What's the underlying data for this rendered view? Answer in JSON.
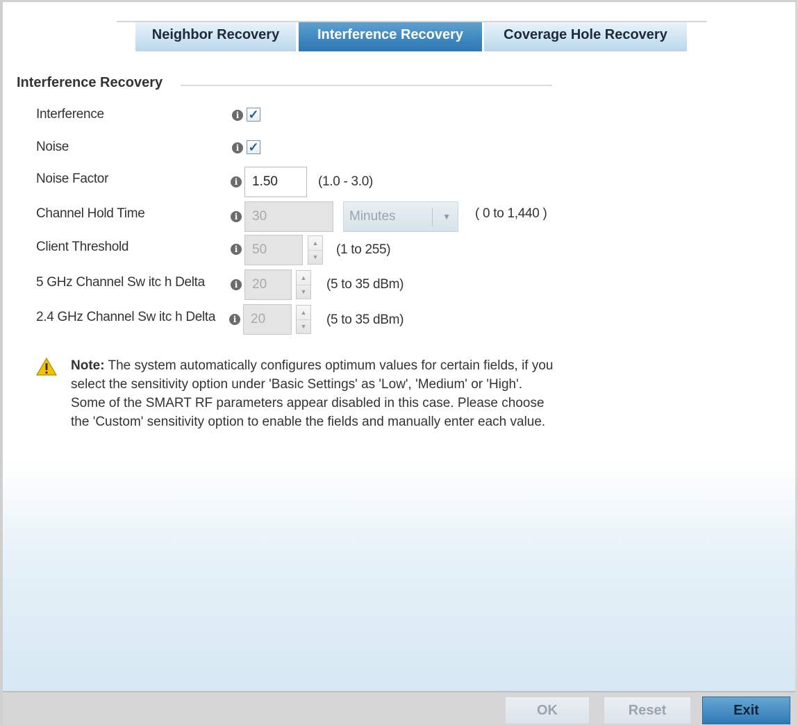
{
  "tabs": [
    {
      "label": "Neighbor Recovery",
      "active": false
    },
    {
      "label": "Interference Recovery",
      "active": true
    },
    {
      "label": "Coverage Hole Recovery",
      "active": false
    }
  ],
  "section": {
    "title": "Interference Recovery"
  },
  "fields": {
    "interference": {
      "label": "Interference",
      "checked": true
    },
    "noise": {
      "label": "Noise",
      "checked": true
    },
    "noise_factor": {
      "label": "Noise Factor",
      "value": "1.50",
      "hint": "(1.0 - 3.0)"
    },
    "channel_hold_time": {
      "label": "Channel Hold Time",
      "value": "30",
      "unit": "Minutes",
      "hint": "( 0 to 1,440 )"
    },
    "client_threshold": {
      "label": "Client Threshold",
      "value": "50",
      "hint": "(1 to 255)"
    },
    "delta_5ghz": {
      "label": "5 GHz Channel Sw itc h Delta",
      "value": "20",
      "hint": "(5 to 35 dBm)"
    },
    "delta_24ghz": {
      "label": "2.4 GHz Channel Sw itc h Delta",
      "value": "20",
      "hint": "(5 to 35 dBm)"
    }
  },
  "note": {
    "prefix": "Note:",
    "text": " The system automatically configures optimum values for certain fields, if you select the sensitivity option under 'Basic Settings' as 'Low', 'Medium' or 'High'. Some of the SMART RF parameters appear disabled in this case. Please choose the 'Custom' sensitivity option to enable the fields and manually enter each value."
  },
  "footer": {
    "ok_label": "OK",
    "reset_label": "Reset",
    "exit_label": "Exit"
  },
  "icons": {
    "info": "info-icon",
    "check": "checkmark-icon",
    "warning": "warning-icon",
    "caret": "chevron-down-icon"
  },
  "colors": {
    "active_tab": "#3d86bf",
    "primary_button": "#2f7ab6",
    "warning": "#f2c200"
  }
}
